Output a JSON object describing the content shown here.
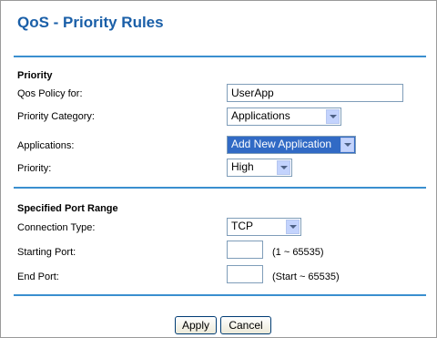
{
  "page": {
    "title": "QoS - Priority Rules"
  },
  "priority_section": {
    "heading": "Priority",
    "policy_label": "Qos Policy for:",
    "policy_value": "UserApp",
    "category_label": "Priority Category:",
    "category_value": "Applications",
    "applications_label": "Applications:",
    "applications_value": "Add New Application",
    "priority_label": "Priority:",
    "priority_value": "High"
  },
  "port_section": {
    "heading": "Specified Port Range",
    "connection_label": "Connection Type:",
    "connection_value": "TCP",
    "start_label": "Starting Port:",
    "start_value": "",
    "start_hint": "(1 ~ 65535)",
    "end_label": "End Port:",
    "end_value": "",
    "end_hint": "(Start ~ 65535)"
  },
  "buttons": {
    "apply": "Apply",
    "cancel": "Cancel"
  },
  "colors": {
    "accent": "#1a5fa8",
    "rule": "#3a8fcf",
    "selection": "#316ac5"
  }
}
